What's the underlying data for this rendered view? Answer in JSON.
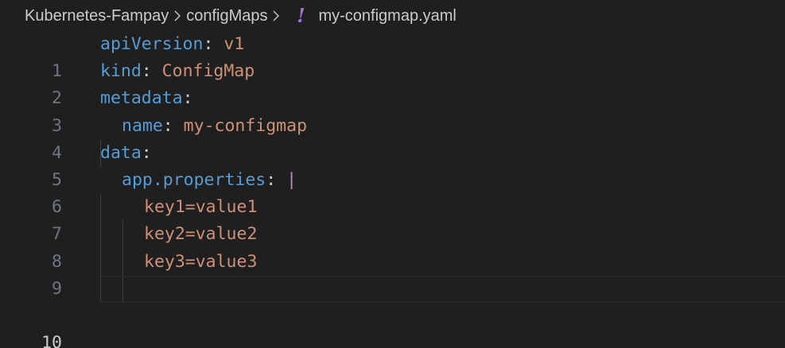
{
  "breadcrumb": {
    "items": [
      "Kubernetes-Fampay",
      "configMaps"
    ],
    "file_icon_glyph": "!",
    "file_name": "my-configmap.yaml"
  },
  "editor": {
    "lines": [
      {
        "number": "1",
        "key": "apiVersion",
        "colon": ":",
        "value": " v1"
      },
      {
        "number": "2",
        "key": "kind",
        "colon": ":",
        "value": " ConfigMap"
      },
      {
        "number": "3",
        "key": "metadata",
        "colon": ":",
        "value": ""
      },
      {
        "number": "4",
        "key": "name",
        "colon": ":",
        "value": " my-configmap"
      },
      {
        "number": "5",
        "key": "data",
        "colon": ":",
        "value": ""
      },
      {
        "number": "6",
        "key": "app.properties",
        "colon": ": ",
        "value": "|"
      },
      {
        "number": "7",
        "key": "",
        "colon": "",
        "value": "key1=value1"
      },
      {
        "number": "8",
        "key": "",
        "colon": "",
        "value": "key2=value2"
      },
      {
        "number": "9",
        "key": "",
        "colon": "",
        "value": "key3=value3"
      },
      {
        "number": "10",
        "key": "",
        "colon": "",
        "value": ""
      }
    ],
    "active_line": "10"
  },
  "colors": {
    "background": "#1f1f1f",
    "key": "#569cd6",
    "string": "#ce9178",
    "block_indicator": "#c586c0",
    "line_number": "#6e7681",
    "line_number_active": "#cccccc",
    "yaml_icon": "#a074c4"
  },
  "icons": {
    "separator": "chevron-right-icon",
    "file": "yaml-file-icon"
  }
}
